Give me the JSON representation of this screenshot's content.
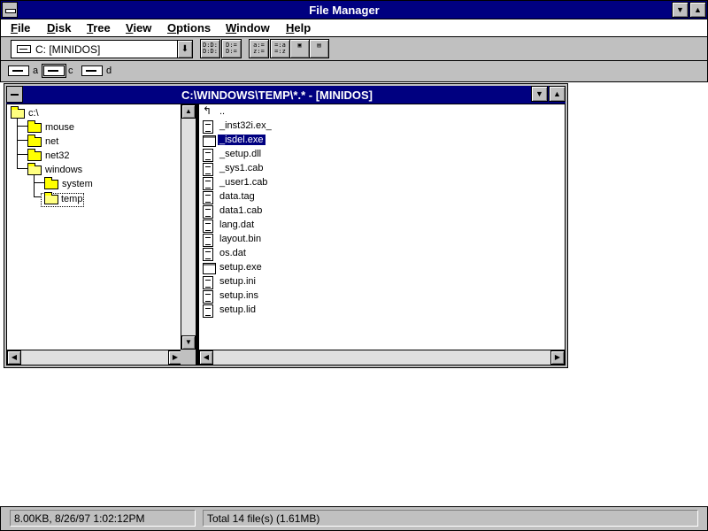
{
  "app": {
    "title": "File Manager"
  },
  "menu": [
    "File",
    "Disk",
    "Tree",
    "View",
    "Options",
    "Window",
    "Help"
  ],
  "toolbar": {
    "drive_select": "C: [MINIDOS]",
    "tools": [
      "view-name",
      "view-details",
      "sort-name",
      "sort-type",
      "copy",
      "new-window"
    ]
  },
  "drives": [
    {
      "letter": "a",
      "icon": "floppy-drive-icon",
      "selected": false
    },
    {
      "letter": "c",
      "icon": "hard-drive-icon",
      "selected": true
    },
    {
      "letter": "d",
      "icon": "cdrom-drive-icon",
      "selected": false
    }
  ],
  "child_window": {
    "title": "C:\\WINDOWS\\TEMP\\*.* - [MINIDOS]"
  },
  "tree": [
    {
      "label": "c:\\",
      "depth": 0,
      "open": true
    },
    {
      "label": "mouse",
      "depth": 1,
      "open": false
    },
    {
      "label": "net",
      "depth": 1,
      "open": false
    },
    {
      "label": "net32",
      "depth": 1,
      "open": false
    },
    {
      "label": "windows",
      "depth": 1,
      "open": true
    },
    {
      "label": "system",
      "depth": 2,
      "open": false
    },
    {
      "label": "temp",
      "depth": 2,
      "open": true,
      "selected": true
    }
  ],
  "files": [
    {
      "name": "..",
      "type": "up"
    },
    {
      "name": "_inst32i.ex_",
      "type": "doc"
    },
    {
      "name": "_isdel.exe",
      "type": "exe",
      "selected": true
    },
    {
      "name": "_setup.dll",
      "type": "doc"
    },
    {
      "name": "_sys1.cab",
      "type": "doc"
    },
    {
      "name": "_user1.cab",
      "type": "doc"
    },
    {
      "name": "data.tag",
      "type": "doc"
    },
    {
      "name": "data1.cab",
      "type": "doc"
    },
    {
      "name": "lang.dat",
      "type": "doc"
    },
    {
      "name": "layout.bin",
      "type": "doc"
    },
    {
      "name": "os.dat",
      "type": "doc"
    },
    {
      "name": "setup.exe",
      "type": "exe"
    },
    {
      "name": "setup.ini",
      "type": "text"
    },
    {
      "name": "setup.ins",
      "type": "doc"
    },
    {
      "name": "setup.lid",
      "type": "doc"
    }
  ],
  "status": {
    "selection": "8.00KB, 8/26/97 1:02:12PM",
    "total": "Total 14 file(s) (1.61MB)"
  }
}
